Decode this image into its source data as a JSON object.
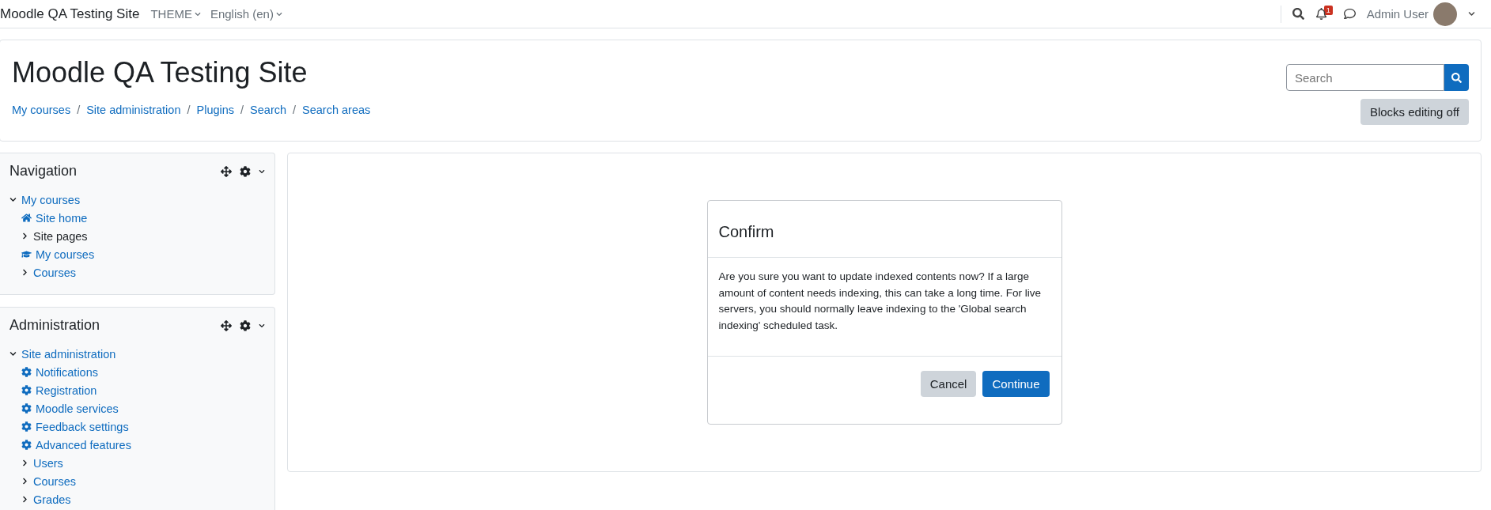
{
  "navbar": {
    "site_name": "Moodle QA Testing Site",
    "menus": [
      {
        "label": "THEME"
      },
      {
        "label": "English (en)"
      }
    ],
    "notification_count": "1",
    "user_name": "Admin User"
  },
  "header": {
    "title": "Moodle QA Testing Site",
    "breadcrumb_separator": "/",
    "breadcrumbs": [
      "My courses",
      "Site administration",
      "Plugins",
      "Search",
      "Search areas"
    ],
    "search": {
      "placeholder": "Search"
    },
    "edit_button": "Blocks editing off"
  },
  "blocks": [
    {
      "title": "Navigation",
      "items": [
        {
          "label": "My courses",
          "kind": "branch",
          "expanded": true,
          "link": true,
          "children": [
            {
              "label": "Site home",
              "kind": "home",
              "link": true
            },
            {
              "label": "Site pages",
              "kind": "branch",
              "expanded": false,
              "link": false
            },
            {
              "label": "My courses",
              "kind": "cap",
              "link": true
            },
            {
              "label": "Courses",
              "kind": "branch",
              "expanded": false,
              "link": true
            }
          ]
        }
      ]
    },
    {
      "title": "Administration",
      "items": [
        {
          "label": "Site administration",
          "kind": "branch",
          "expanded": true,
          "link": true,
          "children": [
            {
              "label": "Notifications",
              "kind": "gear",
              "link": true
            },
            {
              "label": "Registration",
              "kind": "gear",
              "link": true
            },
            {
              "label": "Moodle services",
              "kind": "gear",
              "link": true
            },
            {
              "label": "Feedback settings",
              "kind": "gear",
              "link": true
            },
            {
              "label": "Advanced features",
              "kind": "gear",
              "link": true
            },
            {
              "label": "Users",
              "kind": "branch",
              "expanded": false,
              "link": true
            },
            {
              "label": "Courses",
              "kind": "branch",
              "expanded": false,
              "link": true
            },
            {
              "label": "Grades",
              "kind": "branch",
              "expanded": false,
              "link": true
            }
          ]
        }
      ]
    }
  ],
  "dialog": {
    "title": "Confirm",
    "message": "Are you sure you want to update indexed contents now? If a large amount of content needs indexing, this can take a long time. For live servers, you should normally leave indexing to the 'Global search indexing' scheduled task.",
    "buttons": [
      {
        "label": "Cancel",
        "kind": "secondary"
      },
      {
        "label": "Continue",
        "kind": "primary"
      }
    ]
  }
}
